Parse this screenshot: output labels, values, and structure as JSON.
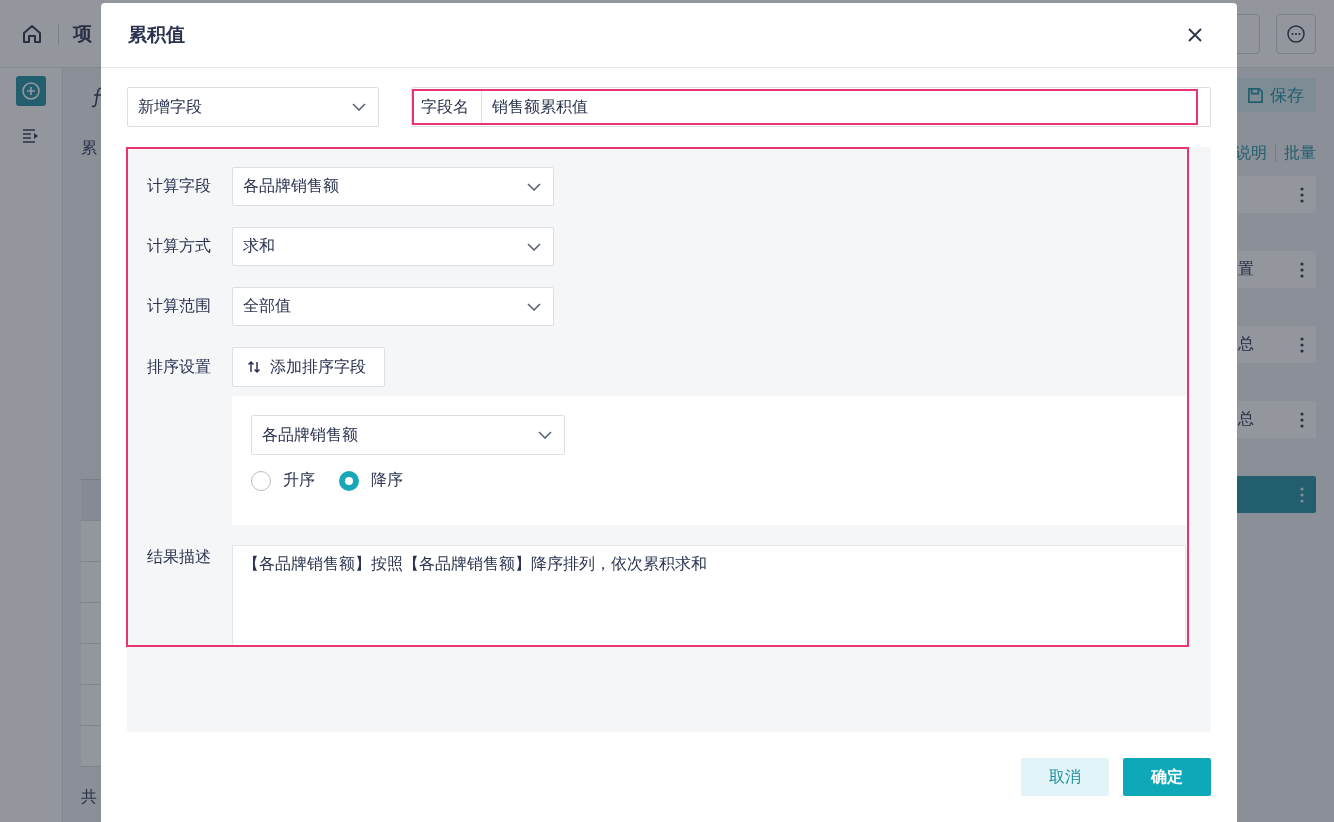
{
  "background": {
    "top_title": "项",
    "side_text": "累",
    "footer_text": "共",
    "save_button": "保存",
    "links": [
      "说明",
      "批量"
    ],
    "cards": [
      {
        "selected": false
      },
      {
        "text": "置",
        "selected": false
      },
      {
        "text": "总",
        "selected": false
      },
      {
        "text": "总",
        "selected": false
      },
      {
        "selected": true
      }
    ]
  },
  "dialog": {
    "title": "累积值",
    "mode_select": {
      "value": "新增字段"
    },
    "field_name": {
      "label": "字段名",
      "value": "销售额累积值"
    },
    "rows": [
      {
        "label": "计算字段",
        "value": "各品牌销售额"
      },
      {
        "label": "计算方式",
        "value": "求和"
      },
      {
        "label": "计算范围",
        "value": "全部值"
      }
    ],
    "sort": {
      "label": "排序设置",
      "add_button": "添加排序字段",
      "field": "各品牌销售额",
      "orders": [
        {
          "label": "升序",
          "selected": false
        },
        {
          "label": "降序",
          "selected": true
        }
      ]
    },
    "result": {
      "label": "结果描述",
      "text": "【各品牌销售额】按照【各品牌销售额】降序排列，依次累积求和"
    },
    "buttons": [
      {
        "label": "取消",
        "kind": "secondary"
      },
      {
        "label": "确定",
        "kind": "primary"
      }
    ]
  }
}
